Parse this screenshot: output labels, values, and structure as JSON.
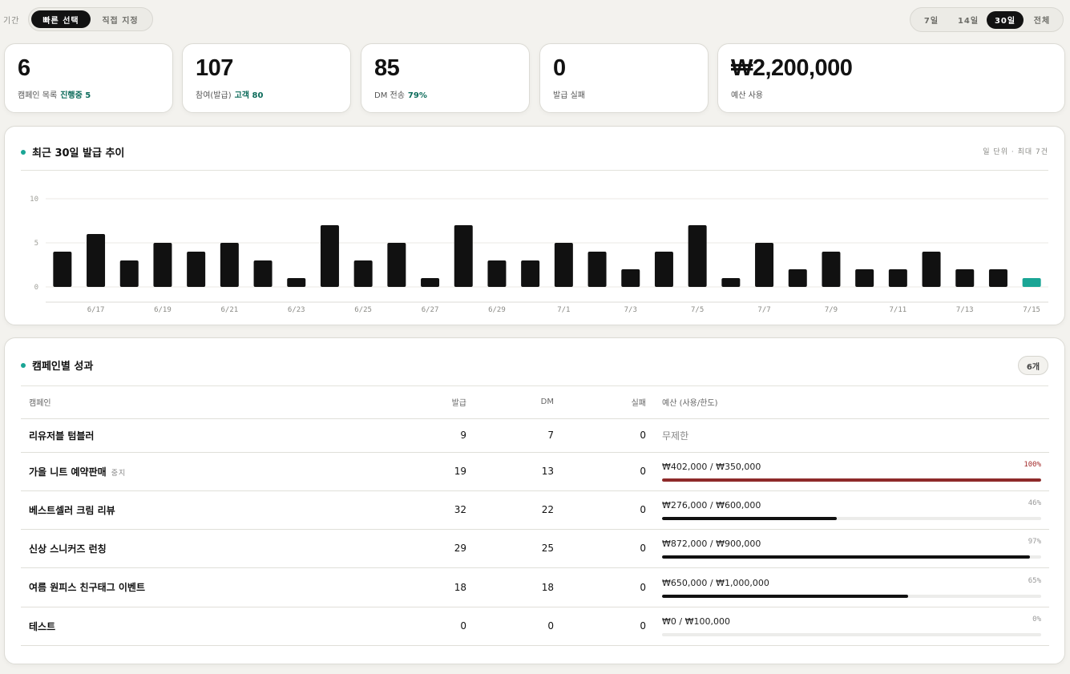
{
  "header": {
    "period_label": "기간",
    "mode_tabs": [
      {
        "label": "빠른 선택",
        "active": true
      },
      {
        "label": "직접 지정",
        "active": false
      }
    ],
    "range_tabs": [
      {
        "label": "7일",
        "active": false
      },
      {
        "label": "14일",
        "active": false
      },
      {
        "label": "30일",
        "active": true
      },
      {
        "label": "전체",
        "active": false
      }
    ]
  },
  "stats": [
    {
      "value": "6",
      "label": "캠페인 목록",
      "accent": "진행중 5"
    },
    {
      "value": "107",
      "label": "참여(발급)",
      "accent": "고객 80"
    },
    {
      "value": "85",
      "label": "DM 전송",
      "accent": "79%"
    },
    {
      "value": "0",
      "label": "발급 실패",
      "accent": ""
    },
    {
      "value": "₩2,200,000",
      "label": "예산 사용",
      "accent": ""
    }
  ],
  "trend": {
    "title": "최근 30일 발급 추이",
    "meta": "일 단위 · 최대 7건"
  },
  "chart_data": {
    "type": "bar",
    "categories": [
      "6/16",
      "6/17",
      "6/18",
      "6/19",
      "6/20",
      "6/21",
      "6/22",
      "6/23",
      "6/24",
      "6/25",
      "6/26",
      "6/27",
      "6/28",
      "6/29",
      "6/30",
      "7/1",
      "7/2",
      "7/3",
      "7/4",
      "7/5",
      "7/6",
      "7/7",
      "7/8",
      "7/9",
      "7/10",
      "7/11",
      "7/12",
      "7/13",
      "7/14",
      "7/15"
    ],
    "x_tick_labels": [
      "6/17",
      "6/19",
      "6/21",
      "6/23",
      "6/25",
      "6/27",
      "6/29",
      "7/1",
      "7/3",
      "7/5",
      "7/7",
      "7/9",
      "7/11",
      "7/13",
      "7/15"
    ],
    "values": [
      4,
      6,
      3,
      5,
      4,
      5,
      3,
      1,
      7,
      3,
      5,
      1,
      7,
      3,
      3,
      5,
      4,
      2,
      4,
      7,
      1,
      5,
      2,
      4,
      2,
      2,
      4,
      2,
      2,
      1
    ],
    "y_ticks": [
      "10",
      "5",
      "0"
    ],
    "ylim": [
      0,
      10
    ],
    "grid": true,
    "highlight_last": true,
    "bar_color": "#111111",
    "highlight_color": "#1aa595"
  },
  "campaigns": {
    "title": "캠페인별 성과",
    "count": "6개",
    "columns": {
      "name": "캠페인",
      "issued": "발급",
      "dm": "DM",
      "failed": "실패",
      "budget": "예산 (사용/한도)"
    },
    "rows": [
      {
        "name": "리유저블 텀블러",
        "tag": "",
        "issued": "9",
        "dm": "7",
        "failed": "0",
        "budget_text": "무제한",
        "unlimited": true,
        "pct_label": "",
        "pct": 0,
        "over": false
      },
      {
        "name": "가을 니트 예약판매",
        "tag": "중지",
        "issued": "19",
        "dm": "13",
        "failed": "0",
        "budget_text": "₩402,000 / ₩350,000",
        "unlimited": false,
        "pct_label": "100%",
        "pct": 100,
        "over": true
      },
      {
        "name": "베스트셀러 크림 리뷰",
        "tag": "",
        "issued": "32",
        "dm": "22",
        "failed": "0",
        "budget_text": "₩276,000 / ₩600,000",
        "unlimited": false,
        "pct_label": "46%",
        "pct": 46,
        "over": false
      },
      {
        "name": "신상 스니커즈 런칭",
        "tag": "",
        "issued": "29",
        "dm": "25",
        "failed": "0",
        "budget_text": "₩872,000 / ₩900,000",
        "unlimited": false,
        "pct_label": "97%",
        "pct": 97,
        "over": false
      },
      {
        "name": "여름 원피스 친구태그 이벤트",
        "tag": "",
        "issued": "18",
        "dm": "18",
        "failed": "0",
        "budget_text": "₩650,000 / ₩1,000,000",
        "unlimited": false,
        "pct_label": "65%",
        "pct": 65,
        "over": false
      },
      {
        "name": "테스트",
        "tag": "",
        "issued": "0",
        "dm": "0",
        "failed": "0",
        "budget_text": "₩0 / ₩100,000",
        "unlimited": false,
        "pct_label": "0%",
        "pct": 0,
        "over": false
      }
    ]
  }
}
